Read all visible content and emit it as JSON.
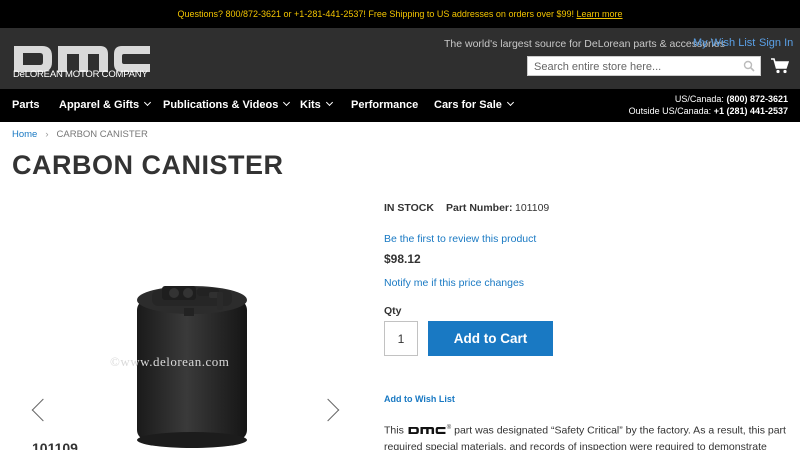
{
  "topbar": {
    "message": "Questions? 800/872-3621 or +1-281-441-2537! Free Shipping to US addresses on orders over $99!",
    "learn_more": "Learn more"
  },
  "header": {
    "logo_subtitle": "DeLOREAN MOTOR COMPANY",
    "tagline": "The world's largest source for DeLorean parts & accessories",
    "wishlist_link": "My Wish List",
    "signin_link": "Sign In",
    "search_placeholder": "Search entire store here...",
    "icons": {
      "search": "search-icon",
      "cart": "cart-icon"
    }
  },
  "nav": {
    "items": [
      {
        "label": "Parts",
        "dropdown": false
      },
      {
        "label": "Apparel & Gifts",
        "dropdown": true
      },
      {
        "label": "Publications & Videos",
        "dropdown": true
      },
      {
        "label": "Kits",
        "dropdown": true
      },
      {
        "label": "Performance",
        "dropdown": false
      },
      {
        "label": "Cars for Sale",
        "dropdown": true
      }
    ],
    "phone_us_label": "US/Canada:",
    "phone_us": "(800) 872-3621",
    "phone_intl_label": "Outside US/Canada:",
    "phone_intl": "+1 (281) 441-2537"
  },
  "breadcrumb": {
    "home": "Home",
    "separator": "›",
    "current": "CARBON CANISTER"
  },
  "product": {
    "title": "CARBON CANISTER",
    "stock": "IN STOCK",
    "part_number_label": "Part Number:",
    "part_number": "101109",
    "review_link": "Be the first to review this product",
    "price": "$98.12",
    "notify_link": "Notify me if this price changes",
    "qty_label": "Qty",
    "qty_value": "1",
    "add_to_cart": "Add to Cart",
    "add_to_wishlist": "Add to Wish List",
    "image_watermark": "©www.delorean.com",
    "image_label": "101109",
    "description_prefix": "This",
    "description_mark": "®",
    "description_text": " part was designated “Safety Critical” by the factory. As a result, this part required special materials, and records of inspection were required to demonstrate supplier"
  },
  "colors": {
    "accent": "#1979c3",
    "topbar_text": "#f3c400",
    "header_bg": "#2f2f2f",
    "nav_bg": "#000000"
  }
}
